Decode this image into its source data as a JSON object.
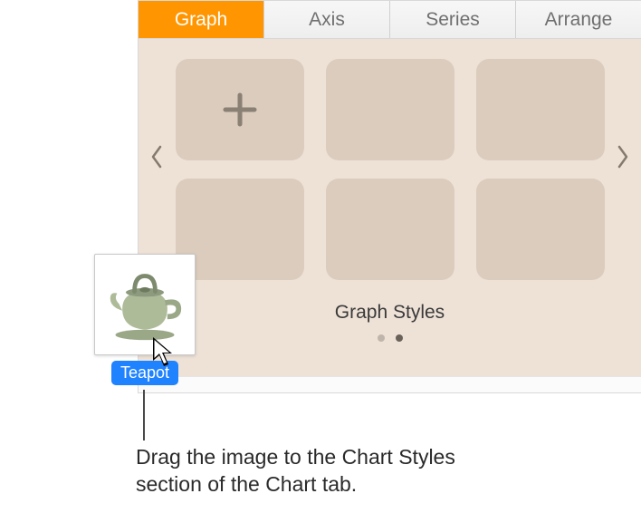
{
  "tabs": {
    "graph": "Graph",
    "axis": "Axis",
    "series": "Series",
    "arrange": "Arrange"
  },
  "styles_section": {
    "title": "Graph Styles"
  },
  "drag_item": {
    "label": "Teapot",
    "icon_name": "teapot-image"
  },
  "callout": {
    "text": "Drag the image to the Chart Styles section of the Chart tab."
  }
}
